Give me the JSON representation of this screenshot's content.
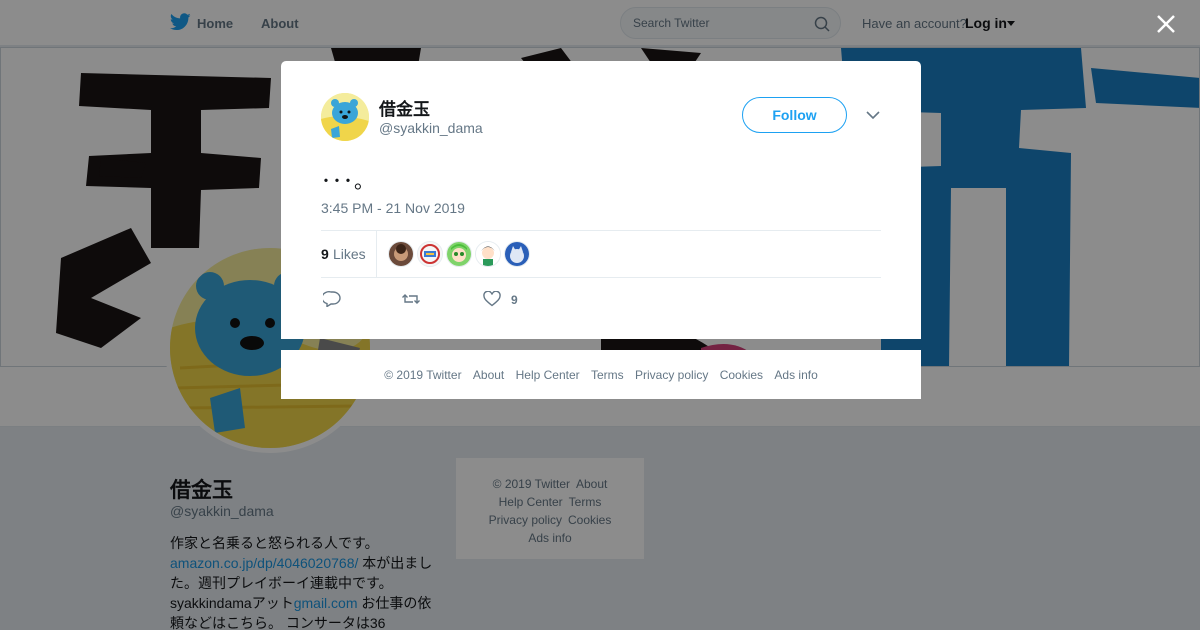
{
  "nav": {
    "home": "Home",
    "about": "About",
    "search_placeholder": "Search Twitter",
    "have_account": "Have an account?",
    "login": "Log in"
  },
  "profile": {
    "name": "借金玉",
    "handle": "@syakkin_dama",
    "bio_1": "作家と名乗ると怒られる人です。",
    "bio_link1": "amazon.co.jp/dp/4046020768/",
    "bio_2": " 本が出ました。週刊プレイボーイ連載中です。 syakkindamaアット",
    "bio_link2": "gmail.com",
    "bio_3": " お仕事の依頼などはこちら。 コンサータは36"
  },
  "side_footer": {
    "copyright": "© 2019 Twitter",
    "about": "About",
    "help": "Help Center",
    "terms": "Terms",
    "privacy": "Privacy policy",
    "cookies": "Cookies",
    "ads": "Ads info"
  },
  "tweet": {
    "name": "借金玉",
    "handle": "@syakkin_dama",
    "follow_label": "Follow",
    "text": "･･･。",
    "timestamp": "3:45 PM - 21 Nov 2019",
    "likes_count": "9",
    "likes_label": "Likes",
    "heart_count": "9"
  },
  "modal_footer": {
    "copyright": "© 2019 Twitter",
    "about": "About",
    "help": "Help Center",
    "terms": "Terms",
    "privacy": "Privacy policy",
    "cookies": "Cookies",
    "ads": "Ads info"
  },
  "colors": {
    "accent": "#1da1f2",
    "link": "#1b95e0",
    "muted": "#657786"
  },
  "icons": [
    "twitter-bird-icon",
    "search-icon",
    "caret-down-icon",
    "close-icon",
    "chevron-down-icon",
    "reply-icon",
    "retweet-icon",
    "heart-icon"
  ]
}
